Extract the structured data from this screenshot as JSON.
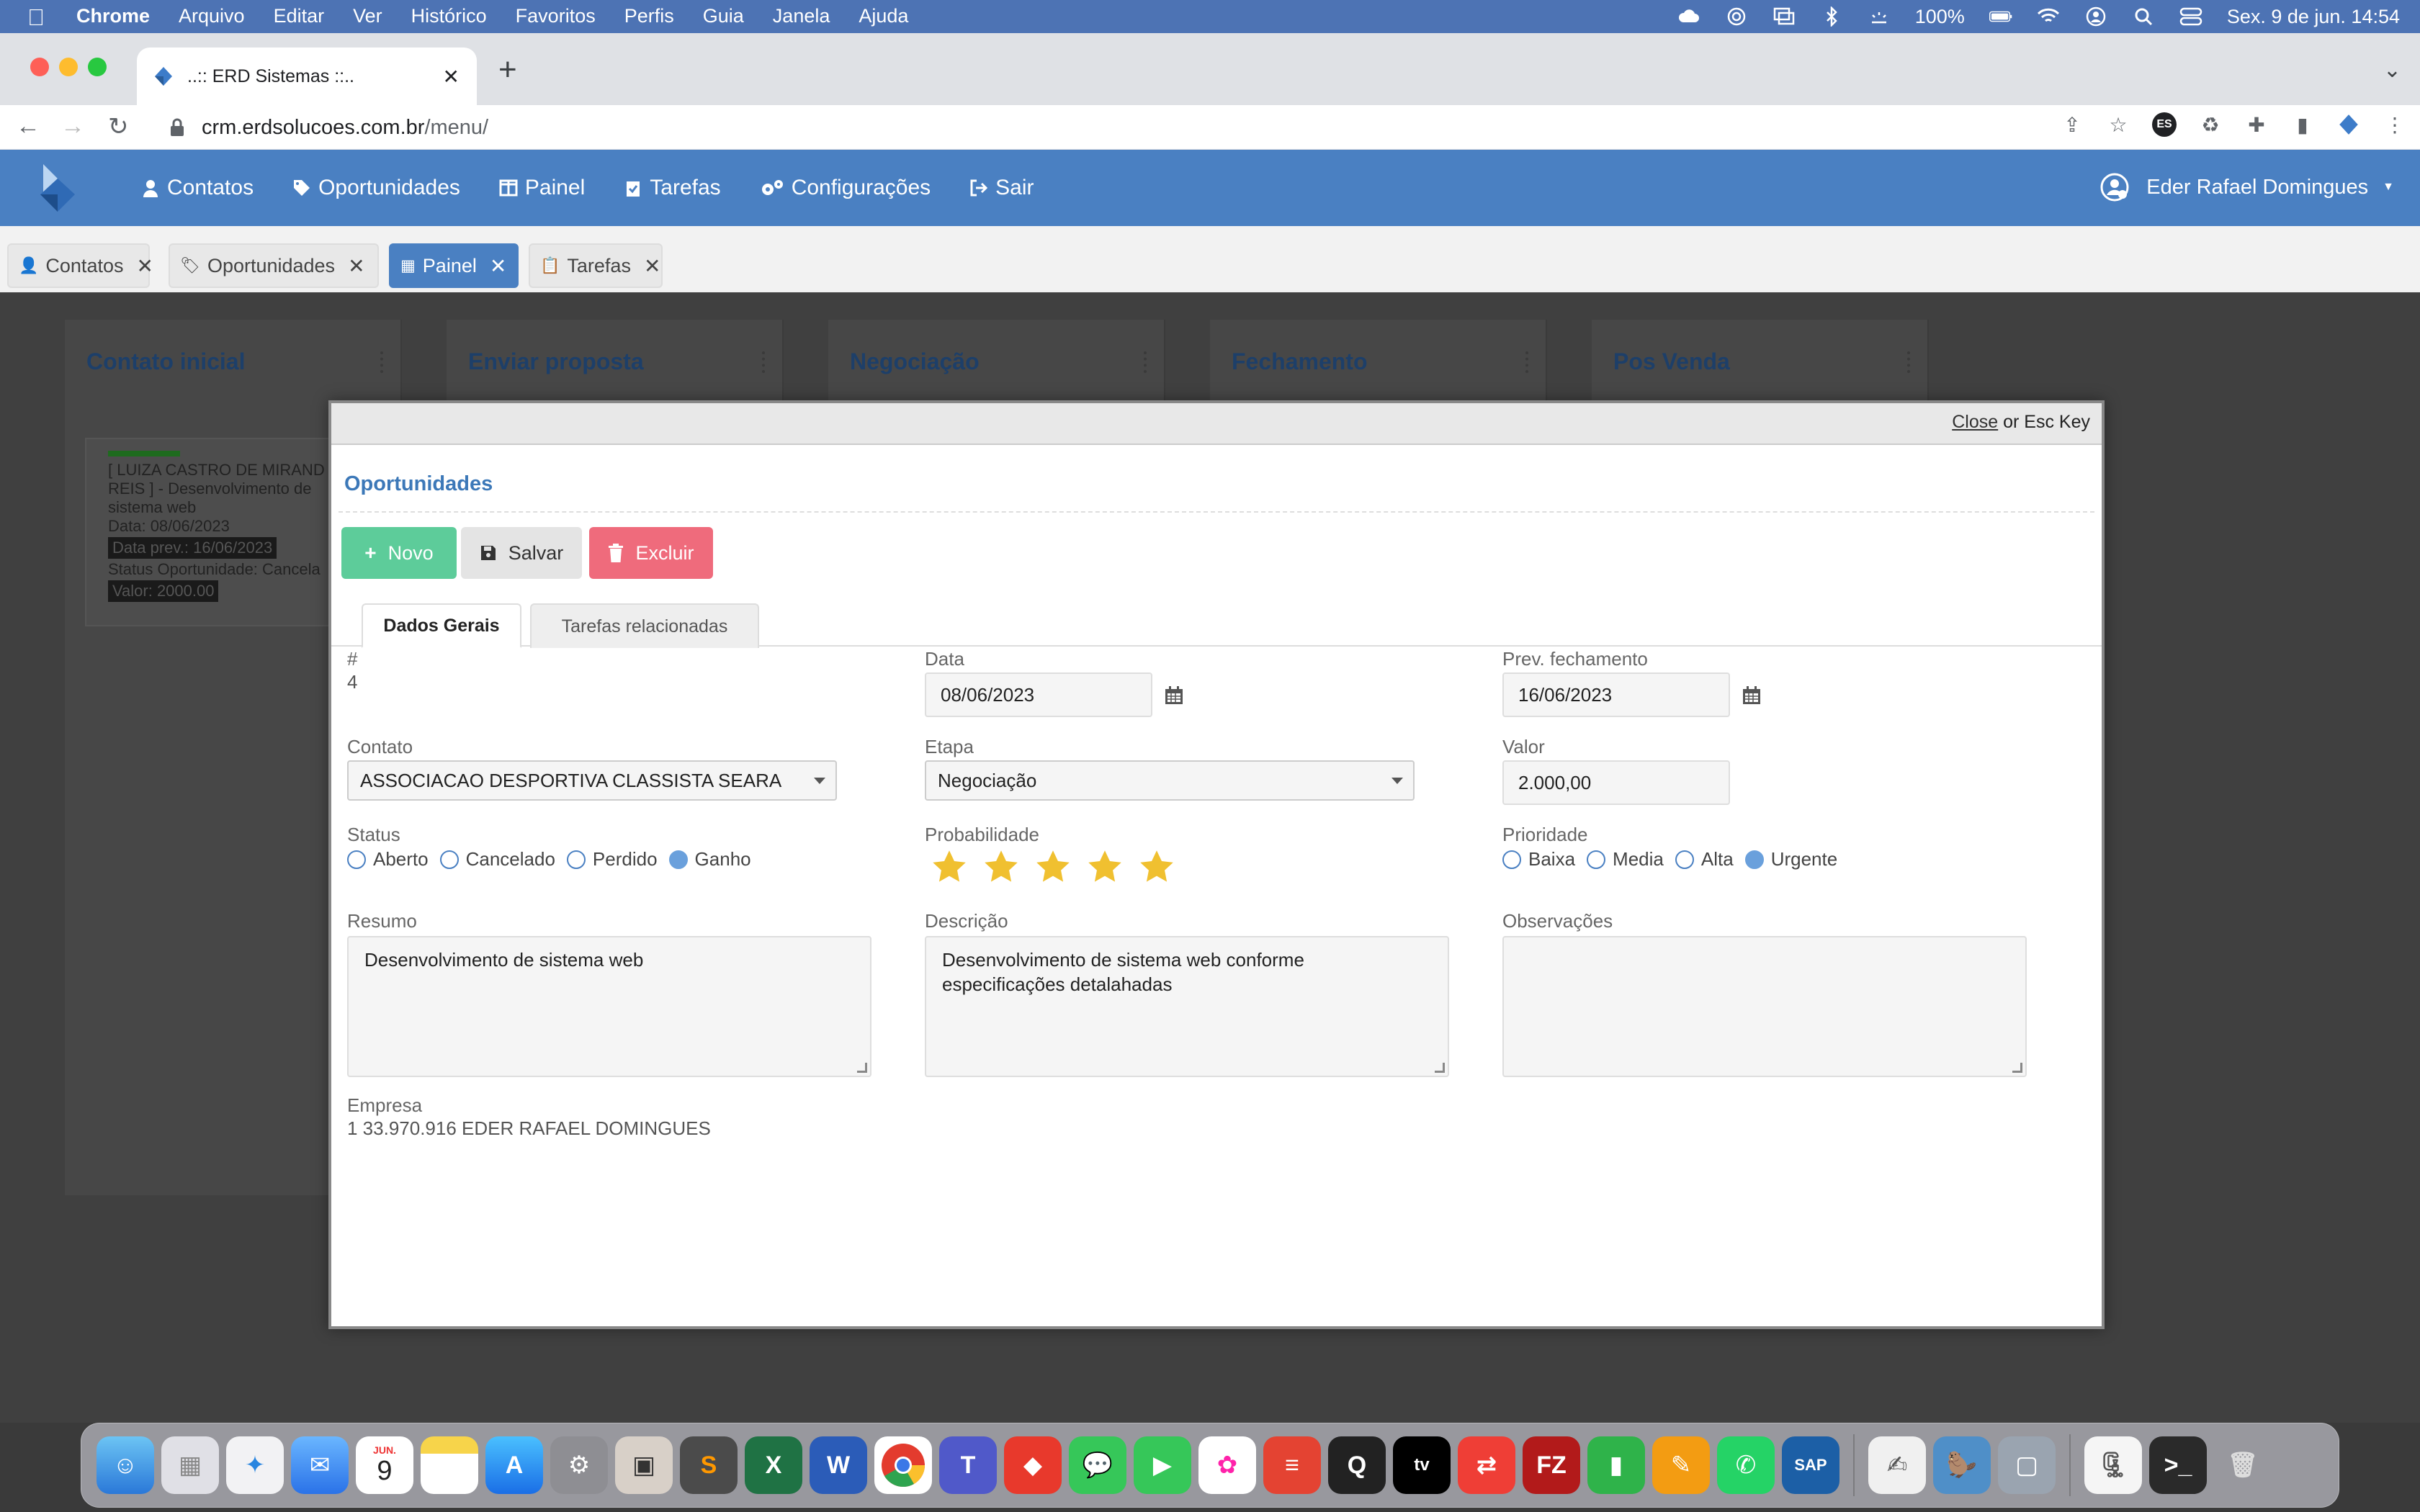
{
  "menubar": {
    "app_name": "Chrome",
    "menus": [
      "Arquivo",
      "Editar",
      "Ver",
      "Histórico",
      "Favoritos",
      "Perfis",
      "Guia",
      "Janela",
      "Ajuda"
    ],
    "battery": "100%",
    "datetime": "Sex. 9 de jun.  14:54"
  },
  "browser": {
    "tab_title": "..:: ERD Sistemas ::..",
    "url_host": "crm.erdsolucoes.com.br",
    "url_path": "/menu/",
    "profile_badge": "ES"
  },
  "app": {
    "nav": [
      "Contatos",
      "Oportunidades",
      "Painel",
      "Tarefas",
      "Configurações",
      "Sair"
    ],
    "user_name": "Eder Rafael Domingues",
    "tabs": [
      "Contatos",
      "Oportunidades",
      "Painel",
      "Tarefas"
    ],
    "active_tab": "Painel",
    "accent": "#4a80c2"
  },
  "board": {
    "columns": [
      "Contato inicial",
      "Enviar proposta",
      "Negociação",
      "Fechamento",
      "Pos Venda"
    ],
    "card": {
      "line1": "[ LUIZA CASTRO DE MIRAND",
      "line2": "REIS ] - Desenvolvimento de",
      "line3": "sistema web",
      "date": "Data: 08/06/2023",
      "prev": "Data prev.: 16/06/2023",
      "status": "Status Oportunidade: Cancela",
      "value": "Valor: 2000.00"
    }
  },
  "modal": {
    "close_link": "Close",
    "close_hint": " or Esc Key",
    "title": "Oportunidades",
    "buttons": {
      "new": "Novo",
      "save": "Salvar",
      "delete": "Excluir"
    },
    "tabs": [
      "Dados Gerais",
      "Tarefas relacionadas"
    ],
    "fields": {
      "id_label": "#",
      "id_value": "4",
      "data_label": "Data",
      "data_value": "08/06/2023",
      "prev_label": "Prev. fechamento",
      "prev_value": "16/06/2023",
      "contato_label": "Contato",
      "contato_value": "ASSOCIACAO DESPORTIVA CLASSISTA SEARA",
      "etapa_label": "Etapa",
      "etapa_value": "Negociação",
      "valor_label": "Valor",
      "valor_value": "2.000,00",
      "status_label": "Status",
      "status_options": [
        "Aberto",
        "Cancelado",
        "Perdido",
        "Ganho"
      ],
      "status_selected": "Ganho",
      "prob_label": "Probabilidade",
      "prob_stars": 5,
      "prioridade_label": "Prioridade",
      "prioridade_options": [
        "Baixa",
        "Media",
        "Alta",
        "Urgente"
      ],
      "prioridade_selected": "Urgente",
      "resumo_label": "Resumo",
      "resumo_value": "Desenvolvimento de sistema web",
      "descricao_label": "Descrição",
      "descricao_value": "Desenvolvimento de sistema web conforme especificações detalahadas",
      "obs_label": "Observações",
      "obs_value": "",
      "empresa_label": "Empresa",
      "empresa_value": "1 33.970.916 EDER RAFAEL DOMINGUES"
    },
    "colors": {
      "new": "#5dcc9a",
      "delete": "#ef6b7c",
      "star": "#f0c030"
    }
  },
  "dock": {
    "apps": [
      "Finder",
      "Launchpad",
      "Safari",
      "Mail",
      "Calendar",
      "Notes",
      "App Store",
      "System Settings",
      "Preview",
      "Sublime Text",
      "Excel",
      "Word",
      "Chrome",
      "Teams",
      "AnyDesk",
      "Messages",
      "FaceTime",
      "Photos",
      "Todoist",
      "QuickTime",
      "Apple TV",
      "AnyConnect",
      "FileZilla",
      "Numbers",
      "Pages",
      "WhatsApp",
      "SAP",
      "TextEdit",
      "Dbeaver",
      "Screenshot",
      "Archive",
      "Terminal",
      "Trash"
    ],
    "calendar_month": "JUN.",
    "calendar_day": "9"
  }
}
